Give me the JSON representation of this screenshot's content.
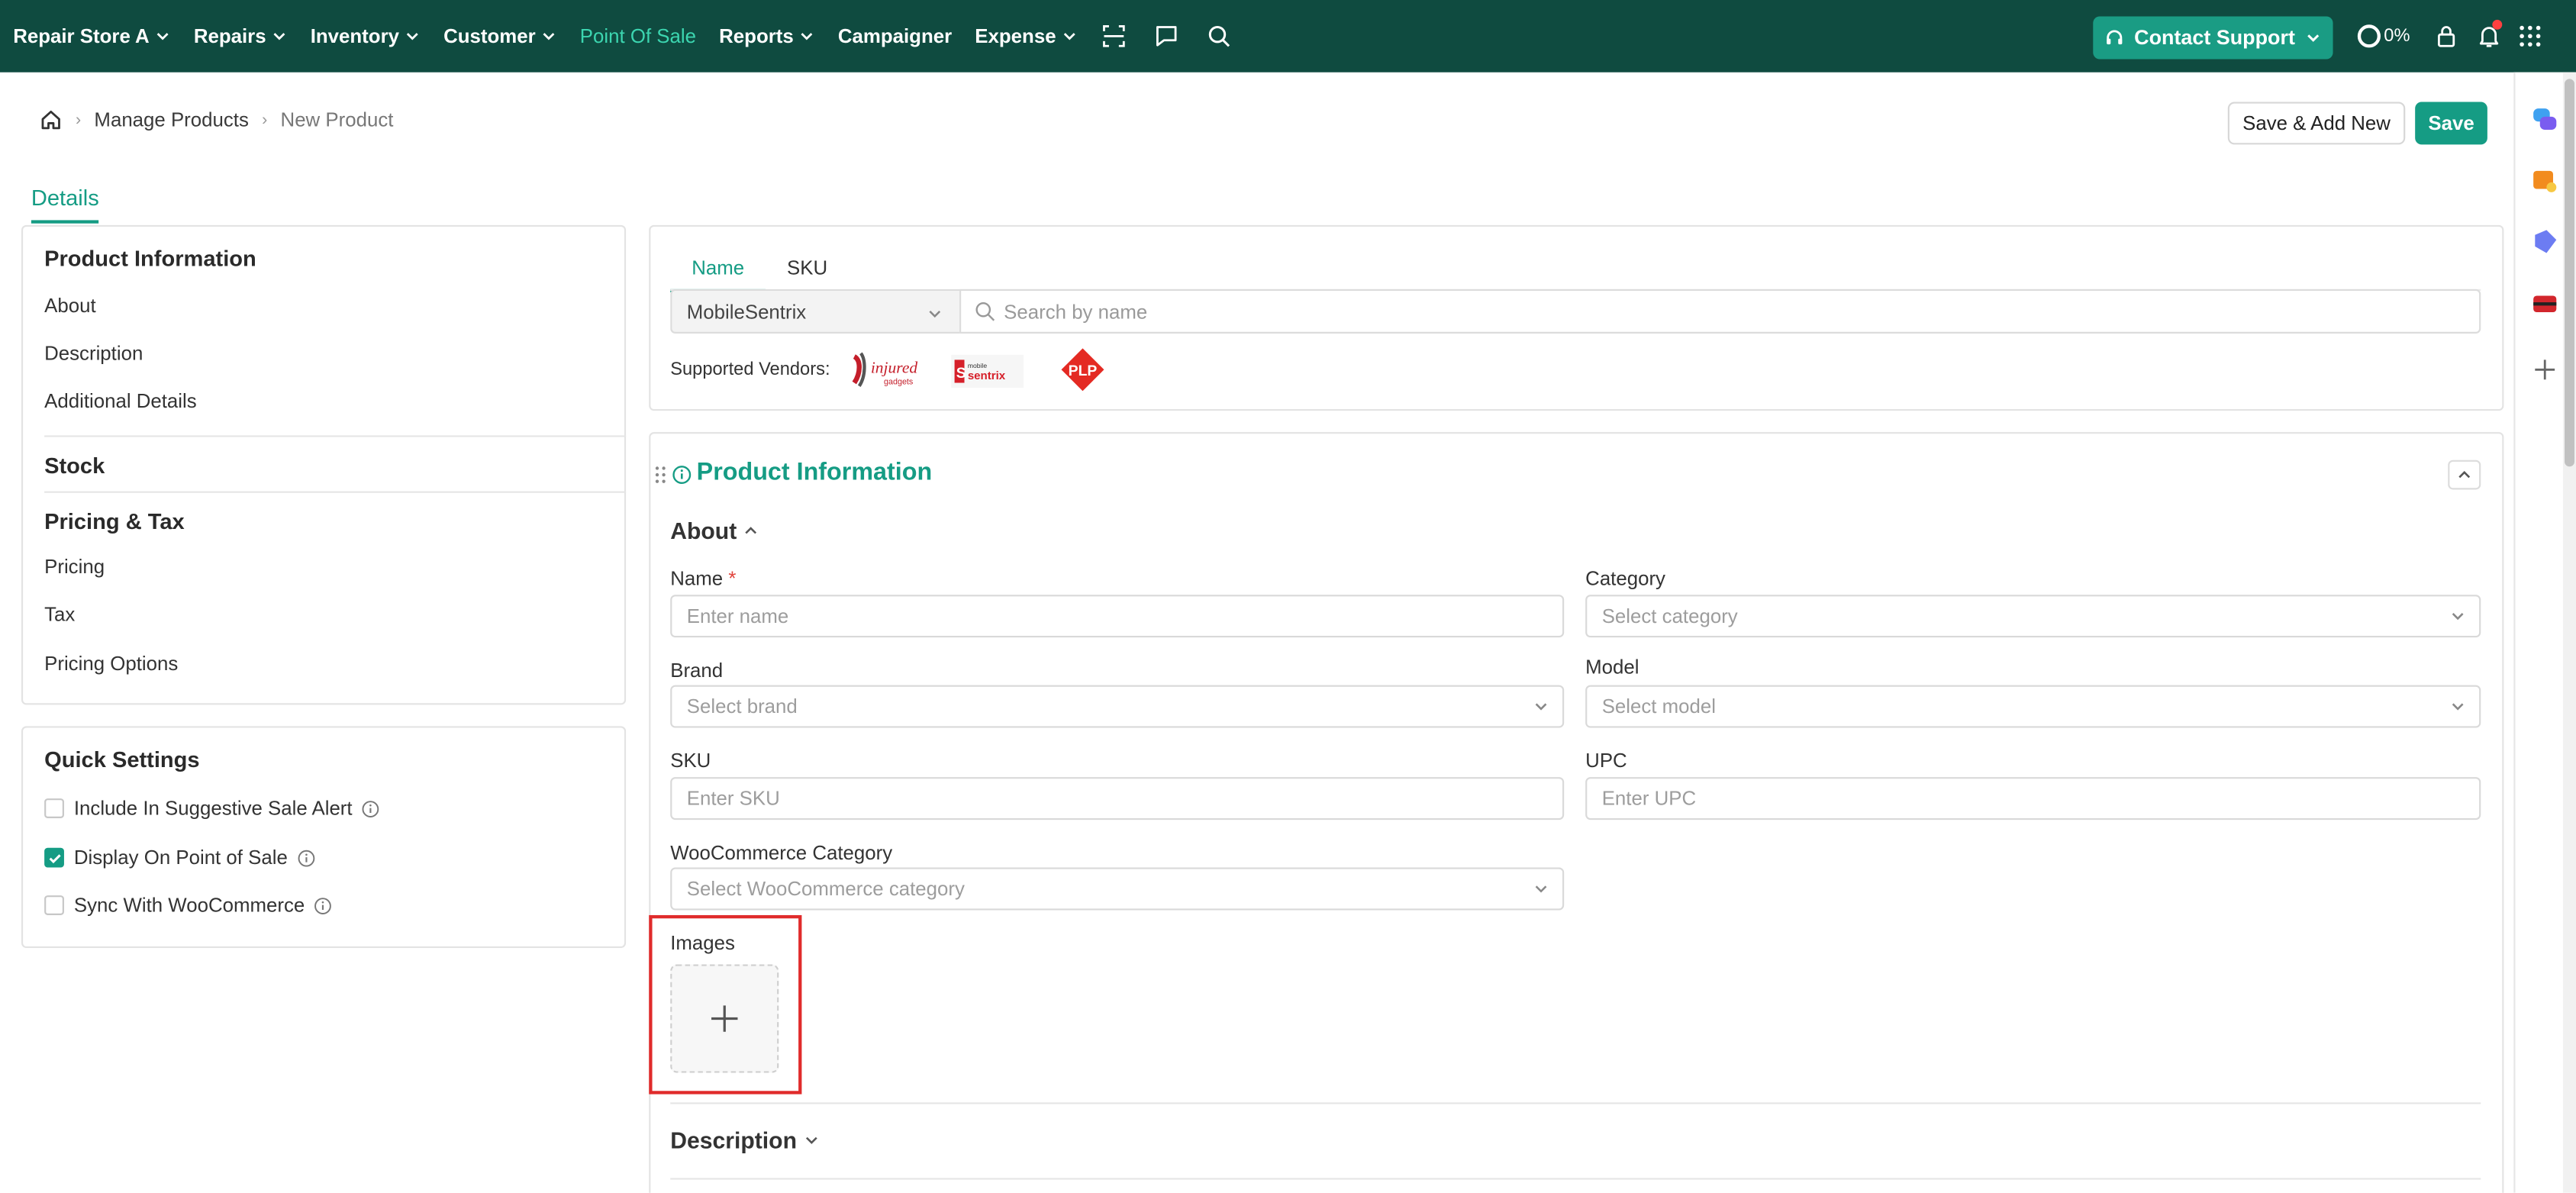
{
  "topnav": {
    "store": "Repair Store A",
    "items": [
      "Repairs",
      "Inventory",
      "Customer",
      "Point Of Sale",
      "Reports",
      "Campaigner",
      "Expense"
    ],
    "support": "Contact Support",
    "progress": "0%"
  },
  "breadcrumb": {
    "manage": "Manage Products",
    "current": "New Product"
  },
  "actions": {
    "save_add_new": "Save & Add New",
    "save": "Save"
  },
  "tabs": {
    "details": "Details"
  },
  "sidebar": {
    "product_info": "Product Information",
    "about": "About",
    "description": "Description",
    "additional": "Additional Details",
    "stock": "Stock",
    "pricing_tax": "Pricing & Tax",
    "pricing": "Pricing",
    "tax": "Tax",
    "pricing_options": "Pricing Options"
  },
  "quick_settings": {
    "title": "Quick Settings",
    "options": [
      {
        "label": "Include In Suggestive Sale Alert",
        "checked": false
      },
      {
        "label": "Display On Point of Sale",
        "checked": true
      },
      {
        "label": "Sync With WooCommerce",
        "checked": false
      }
    ]
  },
  "search_panel": {
    "tab_name": "Name",
    "tab_sku": "SKU",
    "vendor": "MobileSentrix",
    "placeholder": "Search by name",
    "supported_label": "Supported Vendors:",
    "vendor_logos": [
      "injured gadgets",
      "mobile sentrix",
      "PLP"
    ]
  },
  "product_info": {
    "title": "Product Information",
    "about": "About",
    "fields": {
      "name_label": "Name",
      "name_required": "*",
      "name_placeholder": "Enter name",
      "category_label": "Category",
      "category_placeholder": "Select category",
      "brand_label": "Brand",
      "brand_placeholder": "Select brand",
      "model_label": "Model",
      "model_placeholder": "Select model",
      "sku_label": "SKU",
      "sku_placeholder": "Enter SKU",
      "upc_label": "UPC",
      "upc_placeholder": "Enter UPC",
      "woo_label": "WooCommerce Category",
      "woo_placeholder": "Select WooCommerce category",
      "images_label": "Images"
    },
    "description": "Description"
  },
  "colors": {
    "header": "#0f4b40",
    "accent": "#159c84",
    "highlight": "#e02b2b"
  }
}
